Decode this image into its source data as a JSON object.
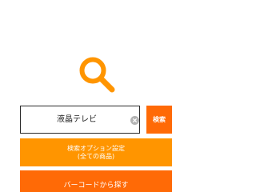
{
  "icons": {
    "hero": "magnifier-icon",
    "clear": "clear-x-icon"
  },
  "search": {
    "value": "液晶テレビ",
    "button_label": "検索"
  },
  "options_button": {
    "line1": "検索オプション設定",
    "line2": "(全ての商品)"
  },
  "barcode_button": {
    "label": "バーコードから探す"
  },
  "colors": {
    "accent_orange": "#ff9500",
    "accent_dark_orange": "#ff6a06",
    "background": "#ffffff"
  }
}
